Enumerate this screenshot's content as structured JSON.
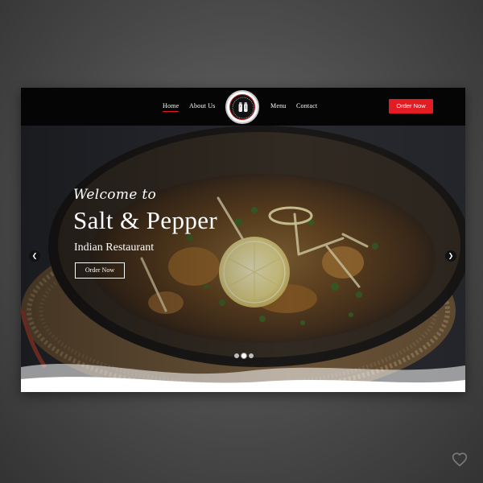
{
  "nav": {
    "links": [
      "Home",
      "About Us",
      "Menu",
      "Contact"
    ],
    "active": "Home",
    "order_label": "Order Now",
    "logo_icon": "salt-and-pepper-logo-icon"
  },
  "hero": {
    "welcome": "Welcome to",
    "title": "Salt & Pepper",
    "subtitle": "Indian Restaurant",
    "button_label": "Order Now",
    "prev_icon": "chevron-left-icon",
    "next_icon": "chevron-right-icon",
    "slides_total": 3,
    "active_slide": 2
  },
  "colors": {
    "accent": "#e31b23",
    "navbar": "#050505",
    "page_background": "#4a4a4a"
  },
  "watermark_icon": "heart-icon"
}
